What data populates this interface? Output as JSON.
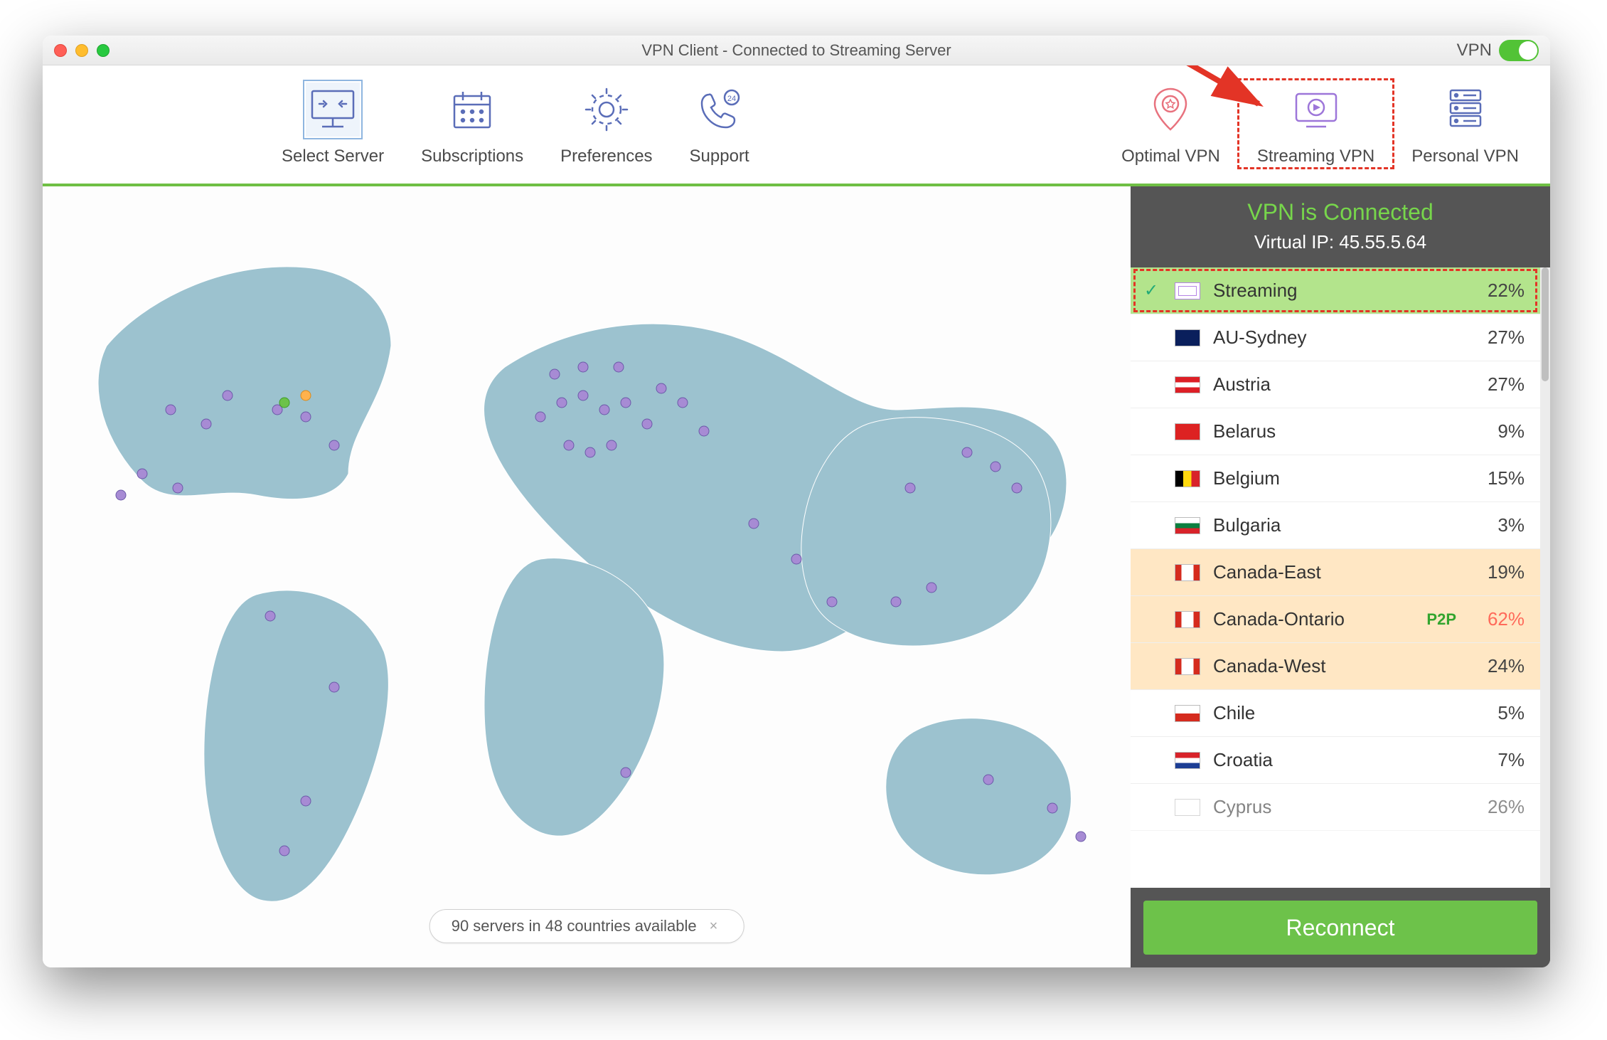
{
  "title": "VPN Client - Connected to Streaming Server",
  "vpn_label": "VPN",
  "toolbar": {
    "select_server": "Select Server",
    "subscriptions": "Subscriptions",
    "preferences": "Preferences",
    "support": "Support",
    "optimal_vpn": "Optimal VPN",
    "streaming_vpn": "Streaming VPN",
    "personal_vpn": "Personal VPN"
  },
  "status": {
    "connected": "VPN is Connected",
    "ip_line": "Virtual IP: 45.55.5.64"
  },
  "servers": [
    {
      "name": "Streaming",
      "pct": "22%",
      "flag": "stream",
      "selected": true
    },
    {
      "name": "AU-Sydney",
      "pct": "27%",
      "flag": "au"
    },
    {
      "name": "Austria",
      "pct": "27%",
      "flag": "at"
    },
    {
      "name": "Belarus",
      "pct": "9%",
      "flag": "by"
    },
    {
      "name": "Belgium",
      "pct": "15%",
      "flag": "be"
    },
    {
      "name": "Bulgaria",
      "pct": "3%",
      "flag": "bg"
    },
    {
      "name": "Canada-East",
      "pct": "19%",
      "flag": "ca",
      "warm": true
    },
    {
      "name": "Canada-Ontario",
      "pct": "62%",
      "flag": "ca",
      "warm": true,
      "badge": "P2P",
      "high": true
    },
    {
      "name": "Canada-West",
      "pct": "24%",
      "flag": "ca",
      "warm": true
    },
    {
      "name": "Chile",
      "pct": "5%",
      "flag": "cl"
    },
    {
      "name": "Croatia",
      "pct": "7%",
      "flag": "hr"
    },
    {
      "name": "Cyprus",
      "pct": "26%",
      "flag": "cy",
      "last": true
    }
  ],
  "server_pill": "90 servers in 48 countries available",
  "reconnect": "Reconnect"
}
